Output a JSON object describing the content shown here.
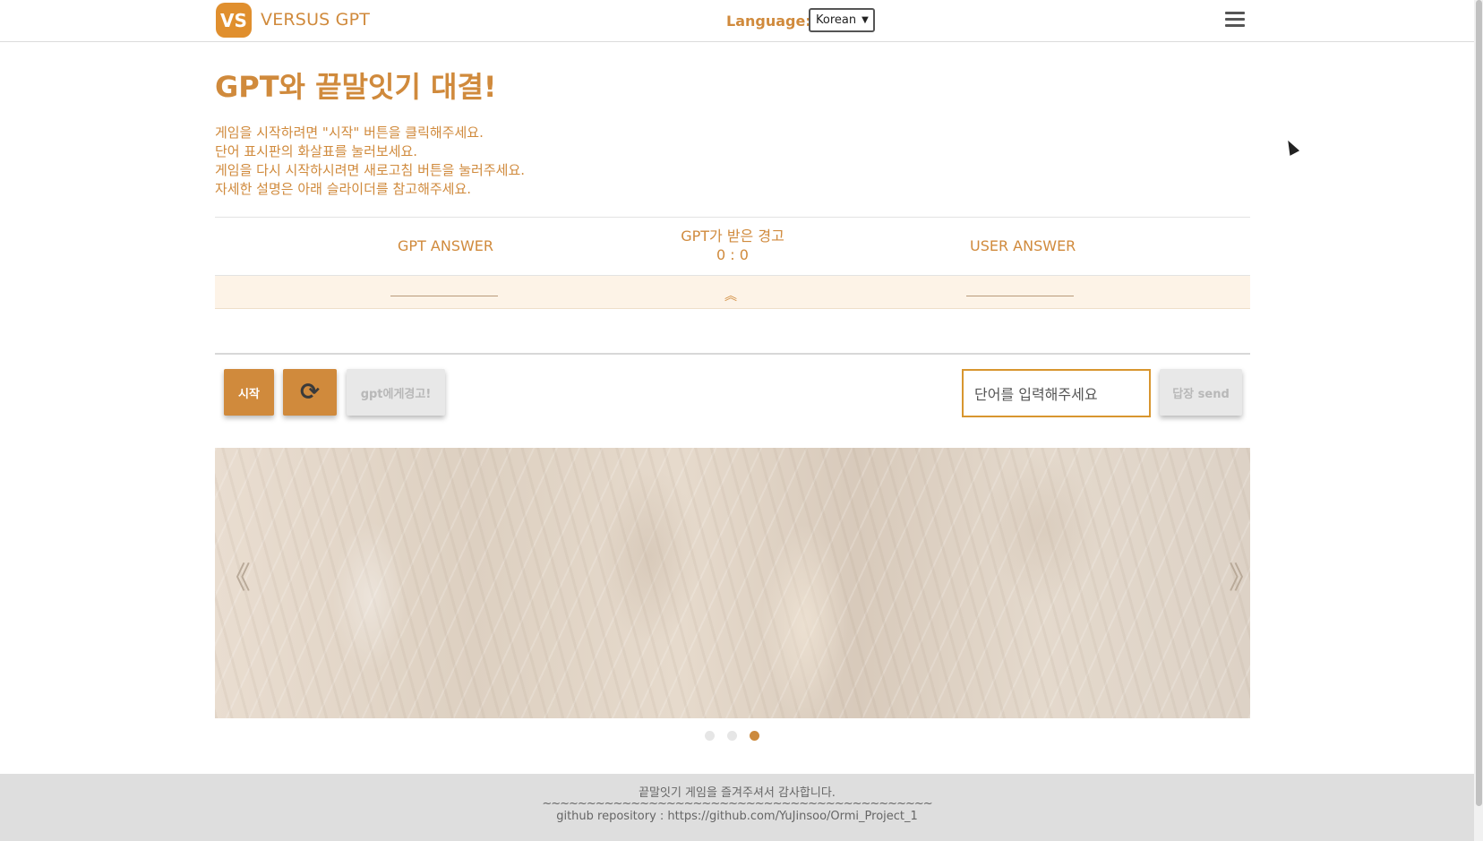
{
  "header": {
    "logo_text": "VS",
    "brand": "VERSUS GPT",
    "language_label": "Language:",
    "language_selected": "Korean"
  },
  "main": {
    "title": "GPT와 끝말잇기 대결!",
    "instructions": [
      "게임을 시작하려면 \"시작\" 버튼을 클릭해주세요.",
      "단어 표시판의 화살표를 눌러보세요.",
      "게임을 다시 시작하시려면 새로고침 버튼을 눌러주세요.",
      "자세한 설명은 아래 슬라이더를 참고해주세요."
    ],
    "score": {
      "gpt_answer_label": "GPT ANSWER",
      "warning_label": "GPT가 받은 경고",
      "warning_score": "0 : 0",
      "user_answer_label": "USER ANSWER"
    },
    "controls": {
      "start_label": "시작",
      "refresh_glyph": "⟳",
      "warn_label": "gpt에게경고!",
      "input_placeholder": "단어를 입력해주세요",
      "send_label": "답장 send"
    }
  },
  "slider": {
    "prev_glyph": "《",
    "next_glyph": "》",
    "slide_count": 3,
    "active_index": 2
  },
  "footer": {
    "thanks": "끝말잇기 게임을 즐겨주셔서 감사합니다.",
    "separator": "~~~~~~~~~~~~~~~~~~~~~~~~~~~~~~~~~~~~~~~~~~~~",
    "repo": "github repository : https://github.com/YuJinsoo/Ormi_Project_1"
  },
  "colors": {
    "accent": "#d08a3c",
    "input_border": "#d8962f",
    "disabled_bg": "#e8e8e8",
    "footer_bg": "#dedede"
  }
}
